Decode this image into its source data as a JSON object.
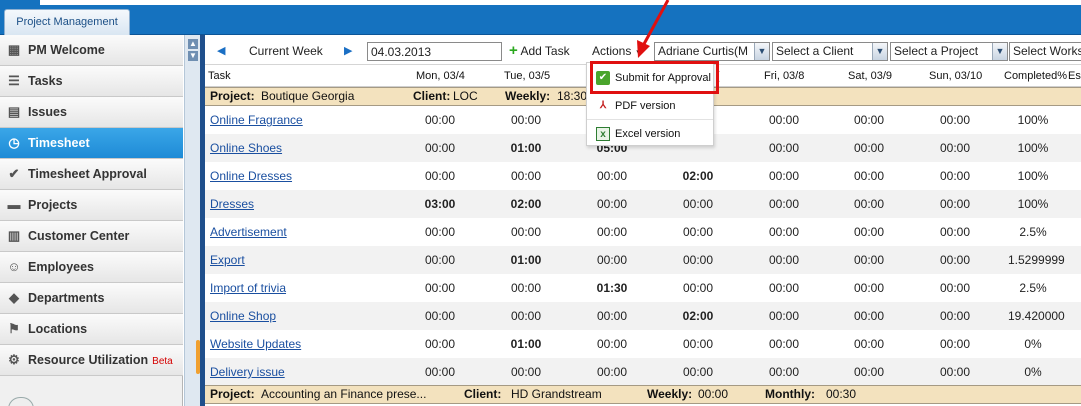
{
  "header": {
    "tab_label": "Project Management"
  },
  "sidebar": {
    "items": [
      {
        "label": "PM Welcome",
        "icon": "grid-icon"
      },
      {
        "label": "Tasks",
        "icon": "list-icon"
      },
      {
        "label": "Issues",
        "icon": "issues-icon"
      },
      {
        "label": "Timesheet",
        "icon": "clock-icon",
        "active": true
      },
      {
        "label": "Timesheet Approval",
        "icon": "check-circle-icon"
      },
      {
        "label": "Projects",
        "icon": "folder-icon"
      },
      {
        "label": "Customer Center",
        "icon": "building-icon"
      },
      {
        "label": "Employees",
        "icon": "people-icon"
      },
      {
        "label": "Departments",
        "icon": "cube-icon"
      },
      {
        "label": "Locations",
        "icon": "flag-icon"
      },
      {
        "label": "Resource Utilization",
        "icon": "resource-icon",
        "badge": "Beta"
      }
    ]
  },
  "toolbar": {
    "period_label": "Current Week",
    "date_value": "04.03.2013",
    "add_task_label": "Add Task",
    "actions_label": "Actions",
    "employee_select": "Adriane Curtis(M",
    "client_select": "Select a Client",
    "project_select": "Select a Project",
    "workspace_select": "Select Works"
  },
  "actions_menu": {
    "items": [
      {
        "label": "Submit for Approval",
        "icon": "approve-check-icon"
      },
      {
        "label": "PDF version",
        "icon": "pdf-icon"
      },
      {
        "label": "Excel version",
        "icon": "excel-icon"
      }
    ]
  },
  "table": {
    "columns": [
      "Task",
      "Mon, 03/4",
      "Tue, 03/5",
      "Fri, 03/8",
      "Sat, 03/9",
      "Sun, 03/10",
      "Completed%",
      "Es"
    ],
    "wed_partial_header": "(",
    "projects": [
      {
        "project_label": "Project:",
        "project_name": "Boutique Georgia",
        "client_label": "Client:",
        "client_name": "LOC",
        "weekly_label": "Weekly:",
        "weekly_value": "18:30"
      },
      {
        "project_label": "Project:",
        "project_name": "Accounting an Finance prese...",
        "client_label": "Client:",
        "client_name": "HD Grandstream",
        "weekly_label": "Weekly:",
        "weekly_value": "00:00",
        "monthly_label": "Monthly:",
        "monthly_value": "00:30"
      }
    ],
    "rows": [
      {
        "task": "Online Fragrance",
        "mon": "00:00",
        "tue": "00:00",
        "wed": "",
        "thu": "",
        "fri": "00:00",
        "sat": "00:00",
        "sun": "00:00",
        "completed": "100%"
      },
      {
        "task": "Online Shoes",
        "mon": "00:00",
        "tue": "01:00",
        "wed": "05:00",
        "thu": "",
        "fri": "00:00",
        "sat": "00:00",
        "sun": "00:00",
        "completed": "100%"
      },
      {
        "task": "Online Dresses",
        "mon": "00:00",
        "tue": "00:00",
        "wed": "00:00",
        "thu": "02:00",
        "fri": "00:00",
        "sat": "00:00",
        "sun": "00:00",
        "completed": "100%"
      },
      {
        "task": "Dresses",
        "mon": "03:00",
        "tue": "02:00",
        "wed": "00:00",
        "thu": "00:00",
        "fri": "00:00",
        "sat": "00:00",
        "sun": "00:00",
        "completed": "100%"
      },
      {
        "task": "Advertisement",
        "mon": "00:00",
        "tue": "00:00",
        "wed": "00:00",
        "thu": "00:00",
        "fri": "00:00",
        "sat": "00:00",
        "sun": "00:00",
        "completed": "2.5%"
      },
      {
        "task": "Export",
        "mon": "00:00",
        "tue": "01:00",
        "wed": "00:00",
        "thu": "00:00",
        "fri": "00:00",
        "sat": "00:00",
        "sun": "00:00",
        "completed": "1.5299999"
      },
      {
        "task": "Import of trivia",
        "mon": "00:00",
        "tue": "00:00",
        "wed": "01:30",
        "thu": "00:00",
        "fri": "00:00",
        "sat": "00:00",
        "sun": "00:00",
        "completed": "2.5%"
      },
      {
        "task": "Online Shop",
        "mon": "00:00",
        "tue": "00:00",
        "wed": "00:00",
        "thu": "02:00",
        "fri": "00:00",
        "sat": "00:00",
        "sun": "00:00",
        "completed": "19.420000"
      },
      {
        "task": "Website Updates",
        "mon": "00:00",
        "tue": "01:00",
        "wed": "00:00",
        "thu": "00:00",
        "fri": "00:00",
        "sat": "00:00",
        "sun": "00:00",
        "completed": "0%"
      },
      {
        "task": "Delivery issue",
        "mon": "00:00",
        "tue": "00:00",
        "wed": "00:00",
        "thu": "00:00",
        "fri": "00:00",
        "sat": "00:00",
        "sun": "00:00",
        "completed": "0%"
      }
    ]
  },
  "colors": {
    "brand_blue": "#1572bf",
    "active_nav": "#1e8bd6",
    "project_band": "#f3e2be",
    "highlight_red": "#e01010",
    "link_blue": "#1a4fa0"
  }
}
